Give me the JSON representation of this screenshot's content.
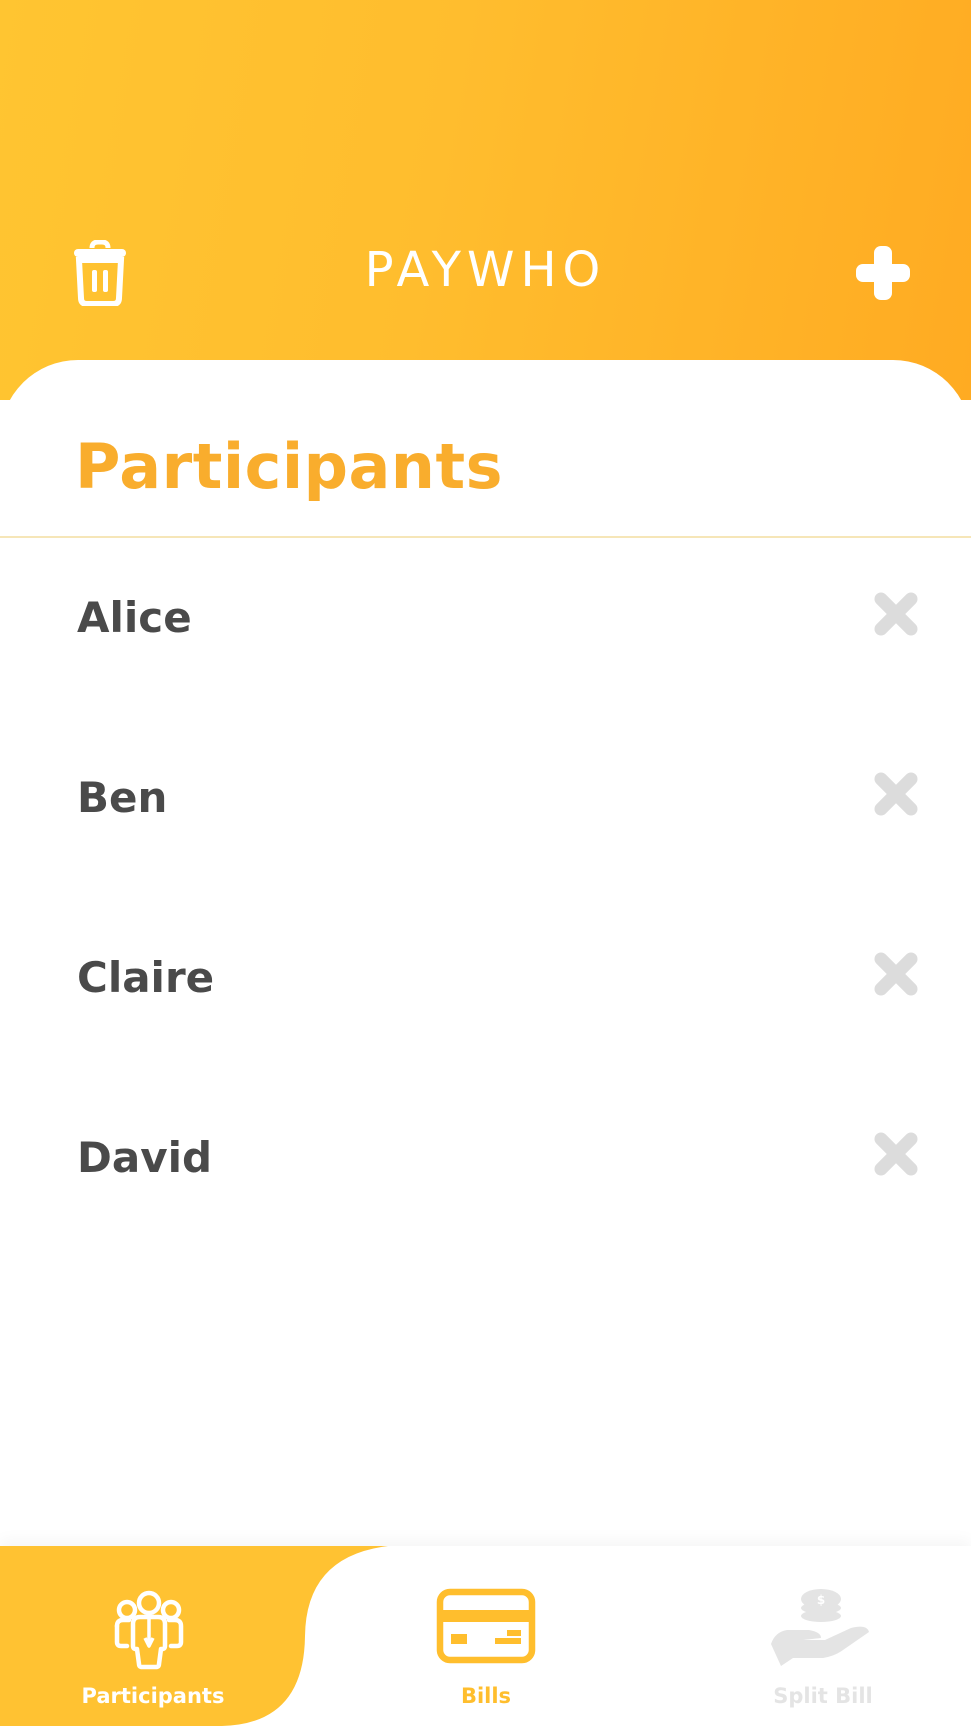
{
  "header": {
    "title": "PAYWHO",
    "gradient_start": "#ffc531",
    "gradient_end": "#ffab22",
    "left_icon": "trash-icon",
    "right_icon": "plus-icon"
  },
  "section": {
    "title": "Participants",
    "accent_color": "#f9ad2d"
  },
  "participants": [
    {
      "name": "Alice",
      "remove_icon": "close-icon"
    },
    {
      "name": "Ben",
      "remove_icon": "close-icon"
    },
    {
      "name": "Claire",
      "remove_icon": "close-icon"
    },
    {
      "name": "David",
      "remove_icon": "close-icon"
    }
  ],
  "tabbar": {
    "tabs": [
      {
        "label": "Participants",
        "icon": "people-icon",
        "active": true,
        "color": "#ffffff"
      },
      {
        "label": "Bills",
        "icon": "credit-card-icon",
        "active": false,
        "color": "#ffbe2d"
      },
      {
        "label": "Split Bill",
        "icon": "hand-coins-icon",
        "active": false,
        "color": "#e4e4e4"
      }
    ],
    "active_bg_color": "#ffc232"
  }
}
